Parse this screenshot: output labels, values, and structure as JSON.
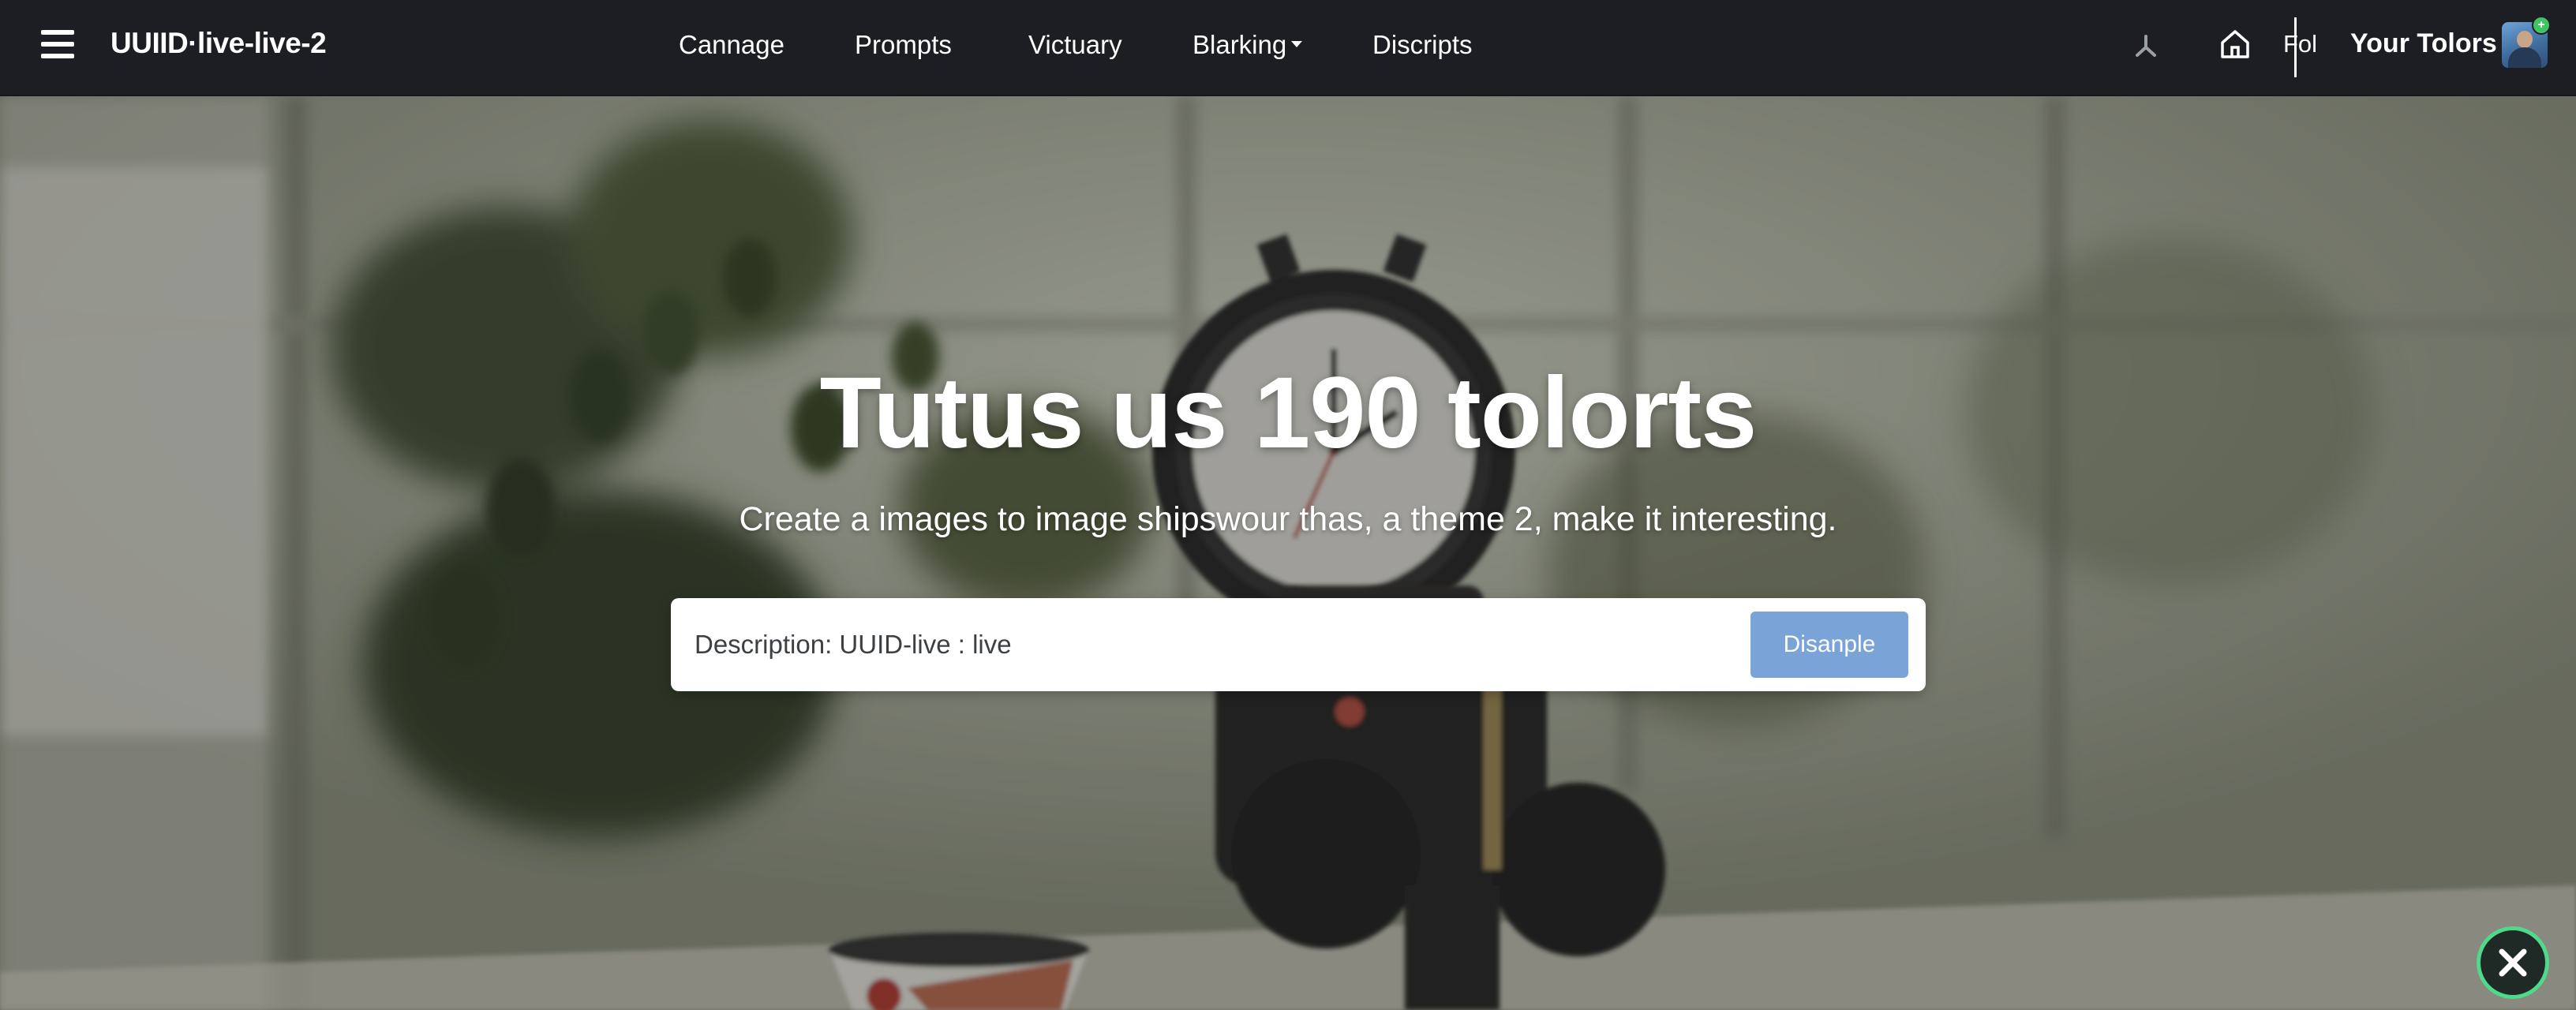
{
  "header": {
    "brand": "UUIID·live-live-2",
    "nav": [
      {
        "label": "Cannage",
        "has_dropdown": false
      },
      {
        "label": "Prompts",
        "has_dropdown": false
      },
      {
        "label": "Victuary",
        "has_dropdown": false
      },
      {
        "label": "Blarking",
        "has_dropdown": true
      },
      {
        "label": "Discripts",
        "has_dropdown": false
      }
    ],
    "icons": [
      "pin-icon",
      "home-icon"
    ],
    "fol_label": "Fol",
    "account_label": "Your Tolors",
    "avatar_badge": "+"
  },
  "hero": {
    "title": "Tutus us 190 tolorts",
    "subtitle": "Create a images to image shipswour thas, a theme 2, make it interesting.",
    "search": {
      "value": "Description: UUID-live : live",
      "placeholder": "",
      "button_label": "Disanple"
    }
  },
  "colors": {
    "topbar_bg": "#1c1e23",
    "accent_button": "#7aa3d8",
    "close_ring": "#4fd98a",
    "badge": "#41c463"
  }
}
